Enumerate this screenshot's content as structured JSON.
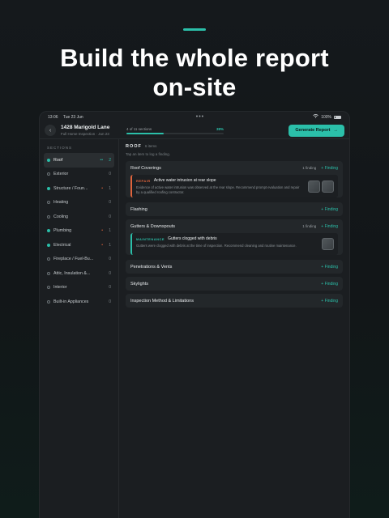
{
  "headline": [
    "Build the whole report",
    "on-site"
  ],
  "status": {
    "time": "13:06",
    "date": "Tue 23 Jun",
    "battery": "100%"
  },
  "header": {
    "address": "1428 Marigold Lane",
    "subtitle": "Full Home Inspection · Jun 23",
    "progress_label": "4 of 11 sections",
    "progress_pct": "38%",
    "progress_value": 0.38,
    "generate_label": "Generate Report"
  },
  "sidebar": {
    "heading": "SECTIONS",
    "items": [
      {
        "label": "Roof",
        "count": "2",
        "done": true,
        "active": true,
        "flag": "••"
      },
      {
        "label": "Exterior",
        "count": "0",
        "done": false,
        "flag": ""
      },
      {
        "label": "Structure / Foun...",
        "count": "1",
        "done": true,
        "flag": "•"
      },
      {
        "label": "Heating",
        "count": "0",
        "done": false,
        "flag": ""
      },
      {
        "label": "Cooling",
        "count": "0",
        "done": false,
        "flag": ""
      },
      {
        "label": "Plumbing",
        "count": "1",
        "done": true,
        "flag": "•"
      },
      {
        "label": "Electrical",
        "count": "1",
        "done": true,
        "flag": "•"
      },
      {
        "label": "Fireplace / Fuel-Bu...",
        "count": "0",
        "done": false,
        "flag": ""
      },
      {
        "label": "Attic, Insulation &...",
        "count": "0",
        "done": false,
        "flag": ""
      },
      {
        "label": "Interior",
        "count": "0",
        "done": false,
        "flag": ""
      },
      {
        "label": "Built-in Appliances",
        "count": "0",
        "done": false,
        "flag": ""
      }
    ]
  },
  "main": {
    "title": "ROOF",
    "count": "6 items",
    "hint": "Tap an item to log a finding.",
    "add_label": "+ Finding",
    "cards": [
      {
        "name": "Roof Coverings",
        "findings_count": "1 finding",
        "finding": {
          "tag": "REPAIR",
          "title": "Active water intrusion at rear slope",
          "desc": "Evidence of active water intrusion was observed at the rear slope. Recommend prompt evaluation and repair by a qualified roofing contractor.",
          "kind": "repair",
          "thumbs": 2
        }
      },
      {
        "name": "Flashing",
        "findings_count": ""
      },
      {
        "name": "Gutters & Downspouts",
        "findings_count": "1 finding",
        "finding": {
          "tag": "MAINTENANCE",
          "title": "Gutters clogged with debris",
          "desc": "Gutters were clogged with debris at the time of inspection. Recommend cleaning and routine maintenance.",
          "kind": "maint",
          "thumbs": 1
        }
      },
      {
        "name": "Penetrations & Vents",
        "findings_count": ""
      },
      {
        "name": "Skylights",
        "findings_count": ""
      },
      {
        "name": "Inspection Method & Limitations",
        "findings_count": ""
      }
    ]
  },
  "colors": {
    "accent": "#2bbfa9",
    "repair": "#e0643c",
    "background": "#15191c"
  }
}
